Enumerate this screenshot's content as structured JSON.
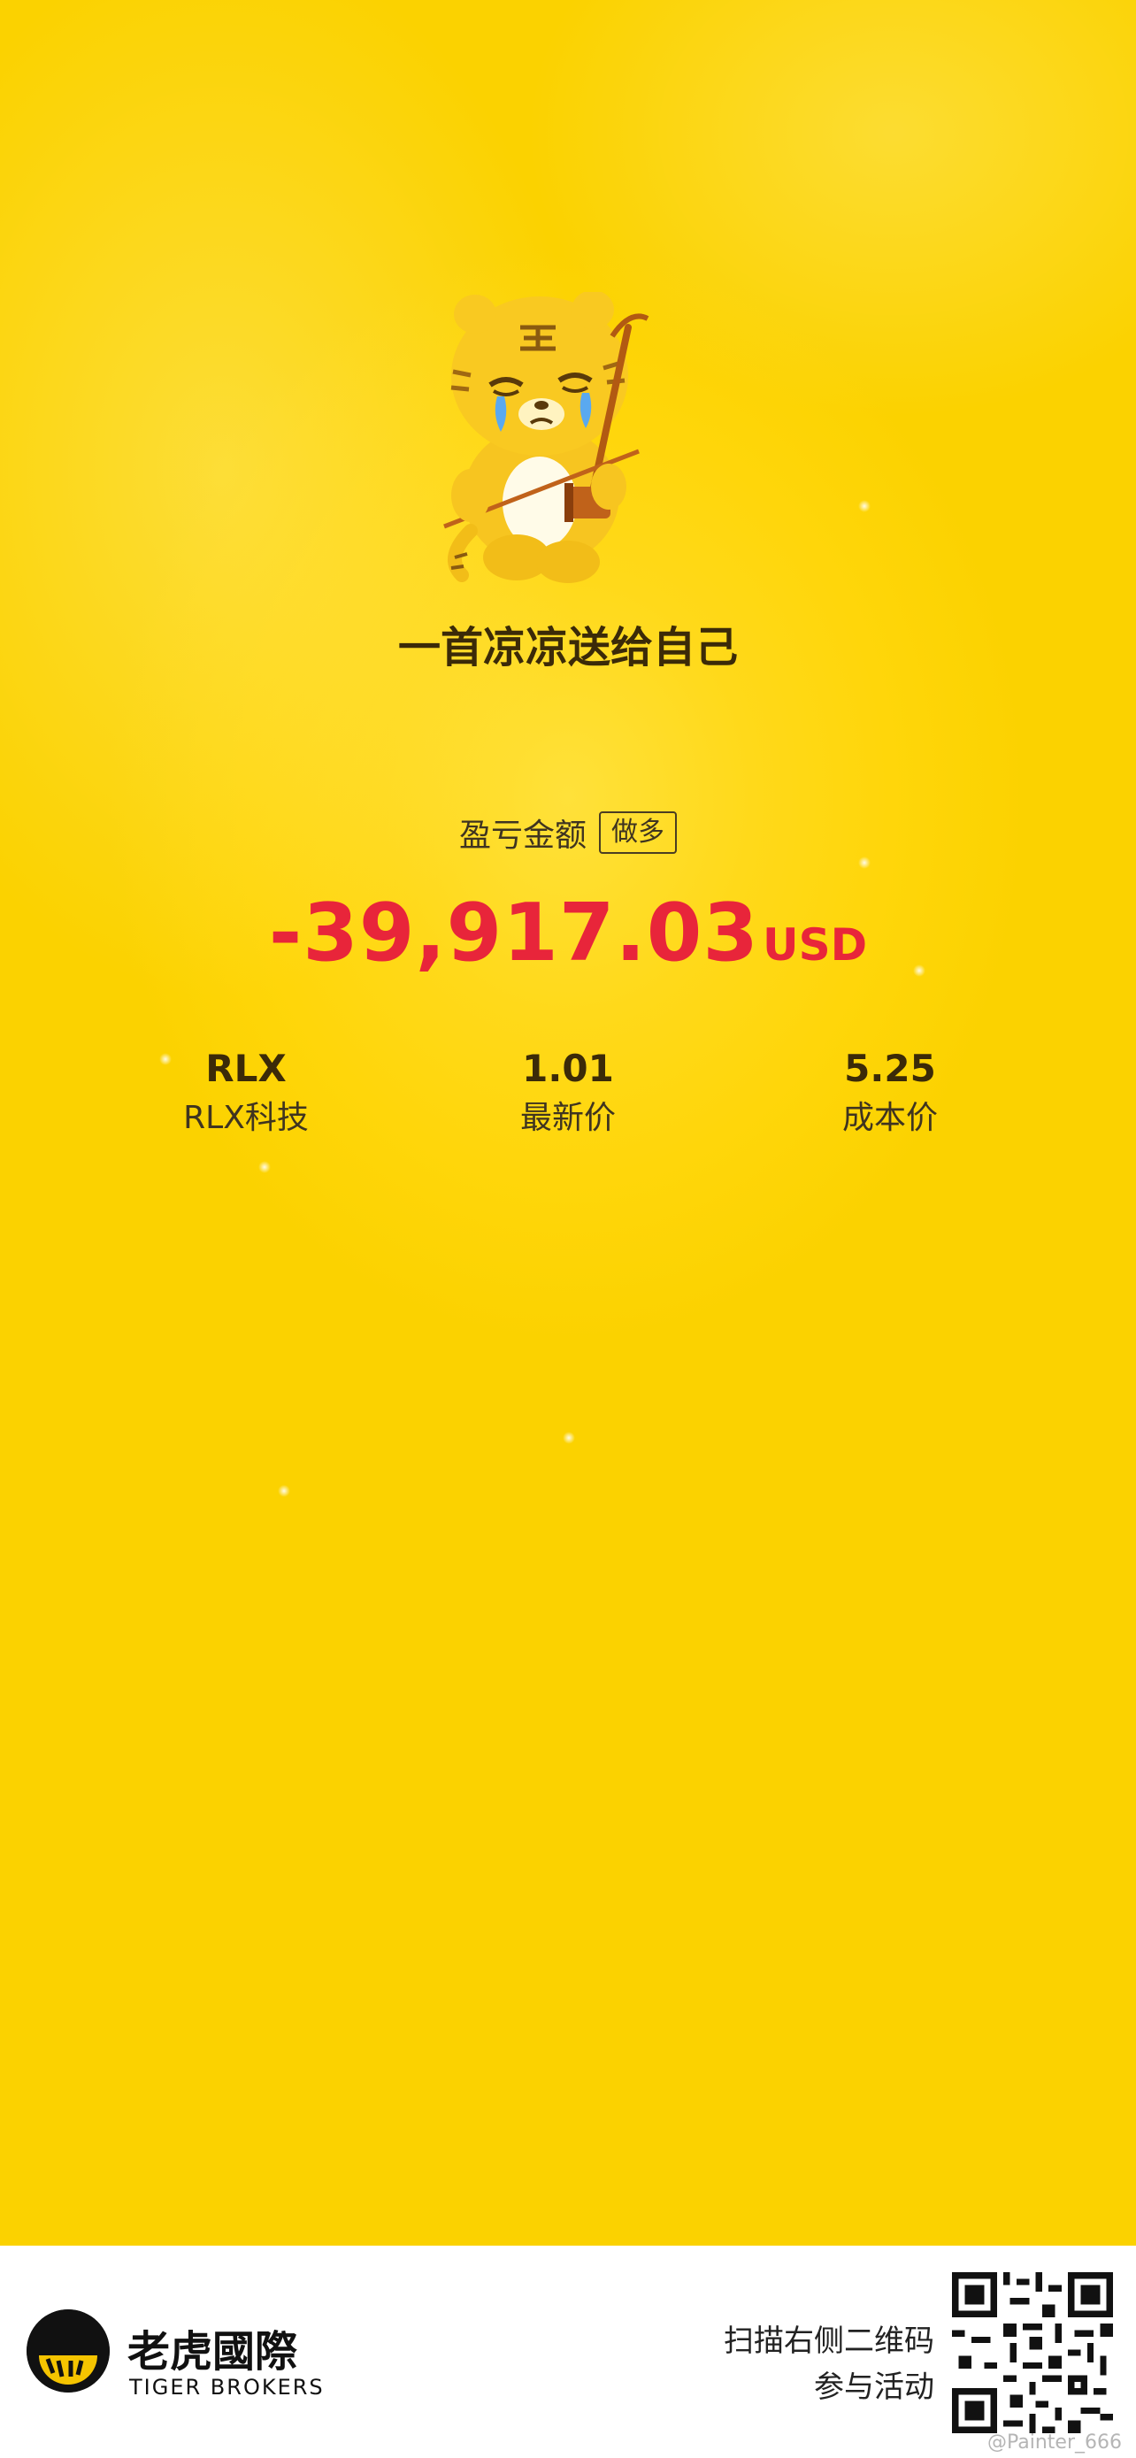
{
  "poster": {
    "title": "一首凉凉送给自己",
    "pl_label": "盈亏金额",
    "position_tag": "做多",
    "pl_amount": "-39,917.03",
    "pl_currency": "USD",
    "colors": {
      "background": "#ffd60a",
      "loss": "#e8253a",
      "text": "#3b2a08"
    }
  },
  "stats": [
    {
      "value": "RLX",
      "label": "RLX科技"
    },
    {
      "value": "1.01",
      "label": "最新价"
    },
    {
      "value": "5.25",
      "label": "成本价"
    }
  ],
  "footer": {
    "brand_cn": "老虎國際",
    "brand_en": "TIGER BROKERS",
    "scan_line1": "扫描右侧二维码",
    "scan_line2": "参与活动",
    "qr_icon": "qr-code-icon",
    "watermark": "@Painter_666"
  }
}
